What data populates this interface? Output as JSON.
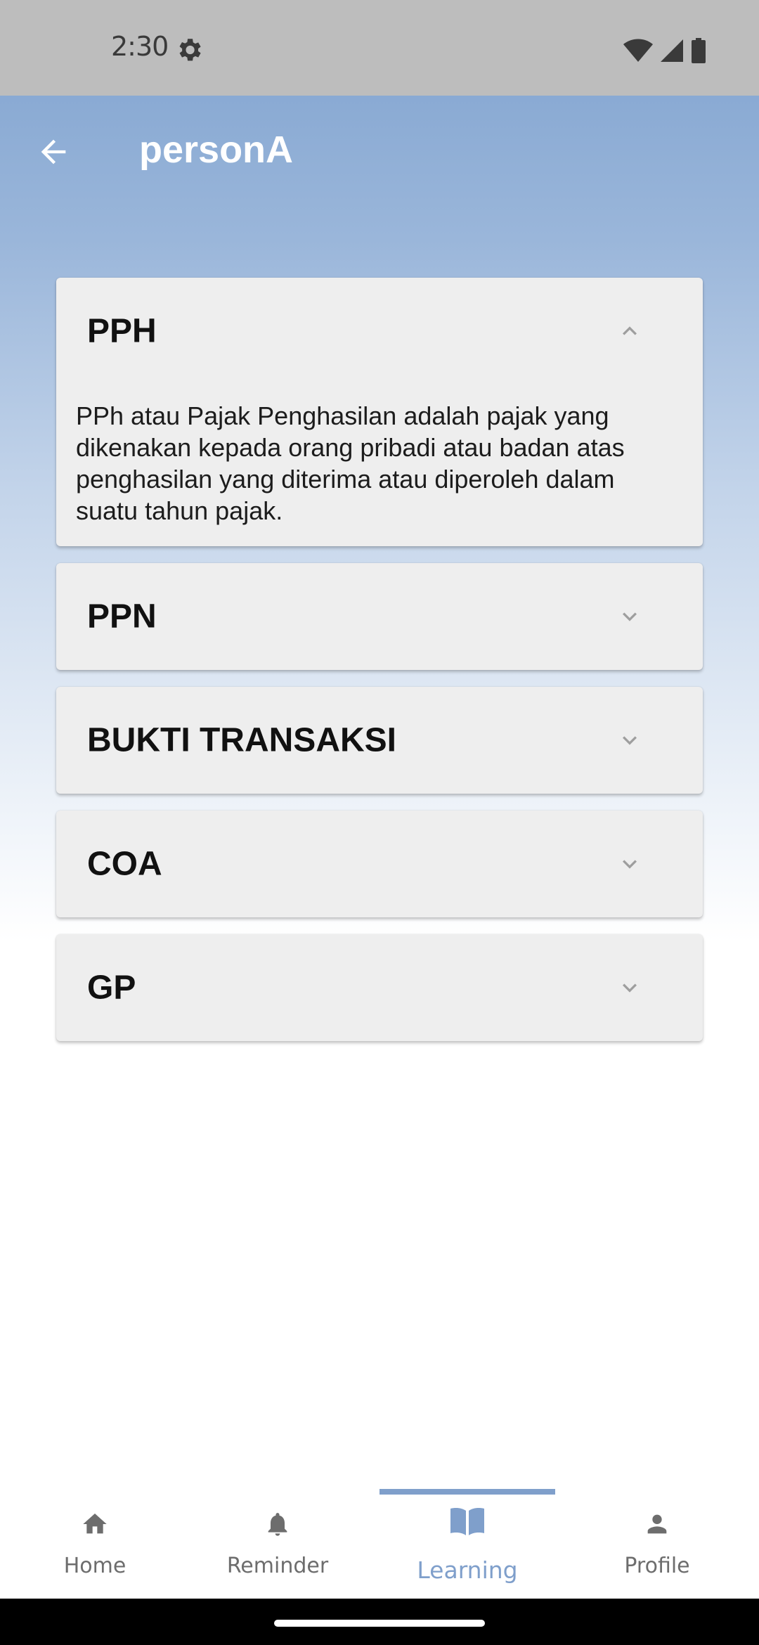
{
  "status_bar": {
    "time": "2:30",
    "icons": [
      "settings-icon",
      "wifi-icon",
      "signal-icon",
      "battery-icon"
    ]
  },
  "app_bar": {
    "title": "personA",
    "back_icon": "arrow-left-icon"
  },
  "accordion": {
    "items": [
      {
        "title": "PPH",
        "expanded": true,
        "content": "PPh atau Pajak Penghasilan adalah pajak yang dikenakan kepada orang pribadi atau badan atas penghasilan yang diterima atau diperoleh dalam suatu tahun pajak."
      },
      {
        "title": "PPN",
        "expanded": false
      },
      {
        "title": "BUKTI TRANSAKSI",
        "expanded": false
      },
      {
        "title": "COA",
        "expanded": false
      },
      {
        "title": "GP",
        "expanded": false
      }
    ]
  },
  "bottom_nav": {
    "items": [
      {
        "label": "Home",
        "icon": "home-icon",
        "active": false
      },
      {
        "label": "Reminder",
        "icon": "bell-icon",
        "active": false
      },
      {
        "label": "Learning",
        "icon": "book-icon",
        "active": true
      },
      {
        "label": "Profile",
        "icon": "person-icon",
        "active": false
      }
    ]
  },
  "colors": {
    "accent": "#7f9fcb",
    "header_top": "#7fa2cf",
    "status_bar": "#bdbdbd",
    "panel": "#eeeeee",
    "inactive_nav": "#6d6d6d"
  }
}
